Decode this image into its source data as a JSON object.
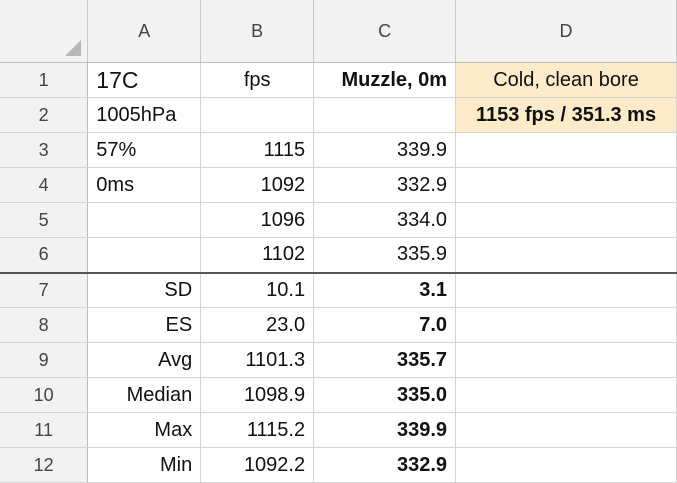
{
  "column_headers": [
    "A",
    "B",
    "C",
    "D"
  ],
  "row_numbers": [
    "1",
    "2",
    "3",
    "4",
    "5",
    "6",
    "7",
    "8",
    "9",
    "10",
    "11",
    "12"
  ],
  "cells": {
    "A1": "17C",
    "B1": "fps",
    "C1": "Muzzle, 0m",
    "D1": "Cold, clean bore",
    "A2": "1005hPa",
    "B2": "",
    "C2": "",
    "D2": "1153 fps / 351.3 ms",
    "A3": "57%",
    "B3": "1115",
    "C3": "339.9",
    "D3": "",
    "A4": "0ms",
    "B4": "1092",
    "C4": "332.9",
    "D4": "",
    "A5": "",
    "B5": "1096",
    "C5": "334.0",
    "D5": "",
    "A6": "",
    "B6": "1102",
    "C6": "335.9",
    "D6": "",
    "A7": "SD",
    "B7": "10.1",
    "C7": "3.1",
    "D7": "",
    "A8": "ES",
    "B8": "23.0",
    "C8": "7.0",
    "D8": "",
    "A9": "Avg",
    "B9": "1101.3",
    "C9": "335.7",
    "D9": "",
    "A10": "Median",
    "B10": "1098.9",
    "C10": "335.0",
    "D10": "",
    "A11": "Max",
    "B11": "1115.2",
    "C11": "339.9",
    "D11": "",
    "A12": "Min",
    "B12": "1092.2",
    "C12": "332.9",
    "D12": ""
  },
  "colors": {
    "highlight_fill": "#fdebc9",
    "header_fill": "#f2f2f2",
    "gridline": "#d4d4d4"
  }
}
